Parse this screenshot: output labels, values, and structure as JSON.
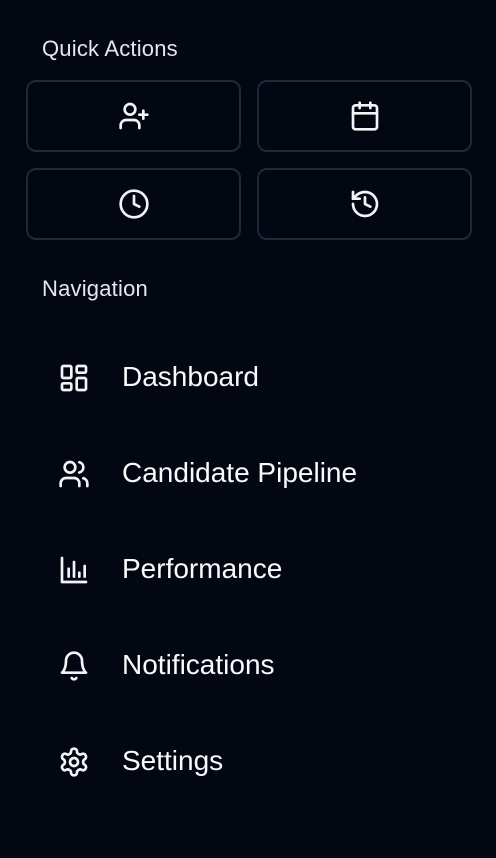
{
  "quick_actions": {
    "title": "Quick Actions",
    "buttons": [
      {
        "icon": "user-plus-icon"
      },
      {
        "icon": "calendar-icon"
      },
      {
        "icon": "clock-icon"
      },
      {
        "icon": "history-icon"
      }
    ]
  },
  "navigation": {
    "title": "Navigation",
    "items": [
      {
        "label": "Dashboard",
        "icon": "dashboard-icon"
      },
      {
        "label": "Candidate Pipeline",
        "icon": "users-icon"
      },
      {
        "label": "Performance",
        "icon": "bar-chart-icon"
      },
      {
        "label": "Notifications",
        "icon": "bell-icon"
      },
      {
        "label": "Settings",
        "icon": "gear-icon"
      }
    ]
  },
  "colors": {
    "background": "#030712",
    "border": "#1f2937",
    "text": "#f9fafb"
  }
}
